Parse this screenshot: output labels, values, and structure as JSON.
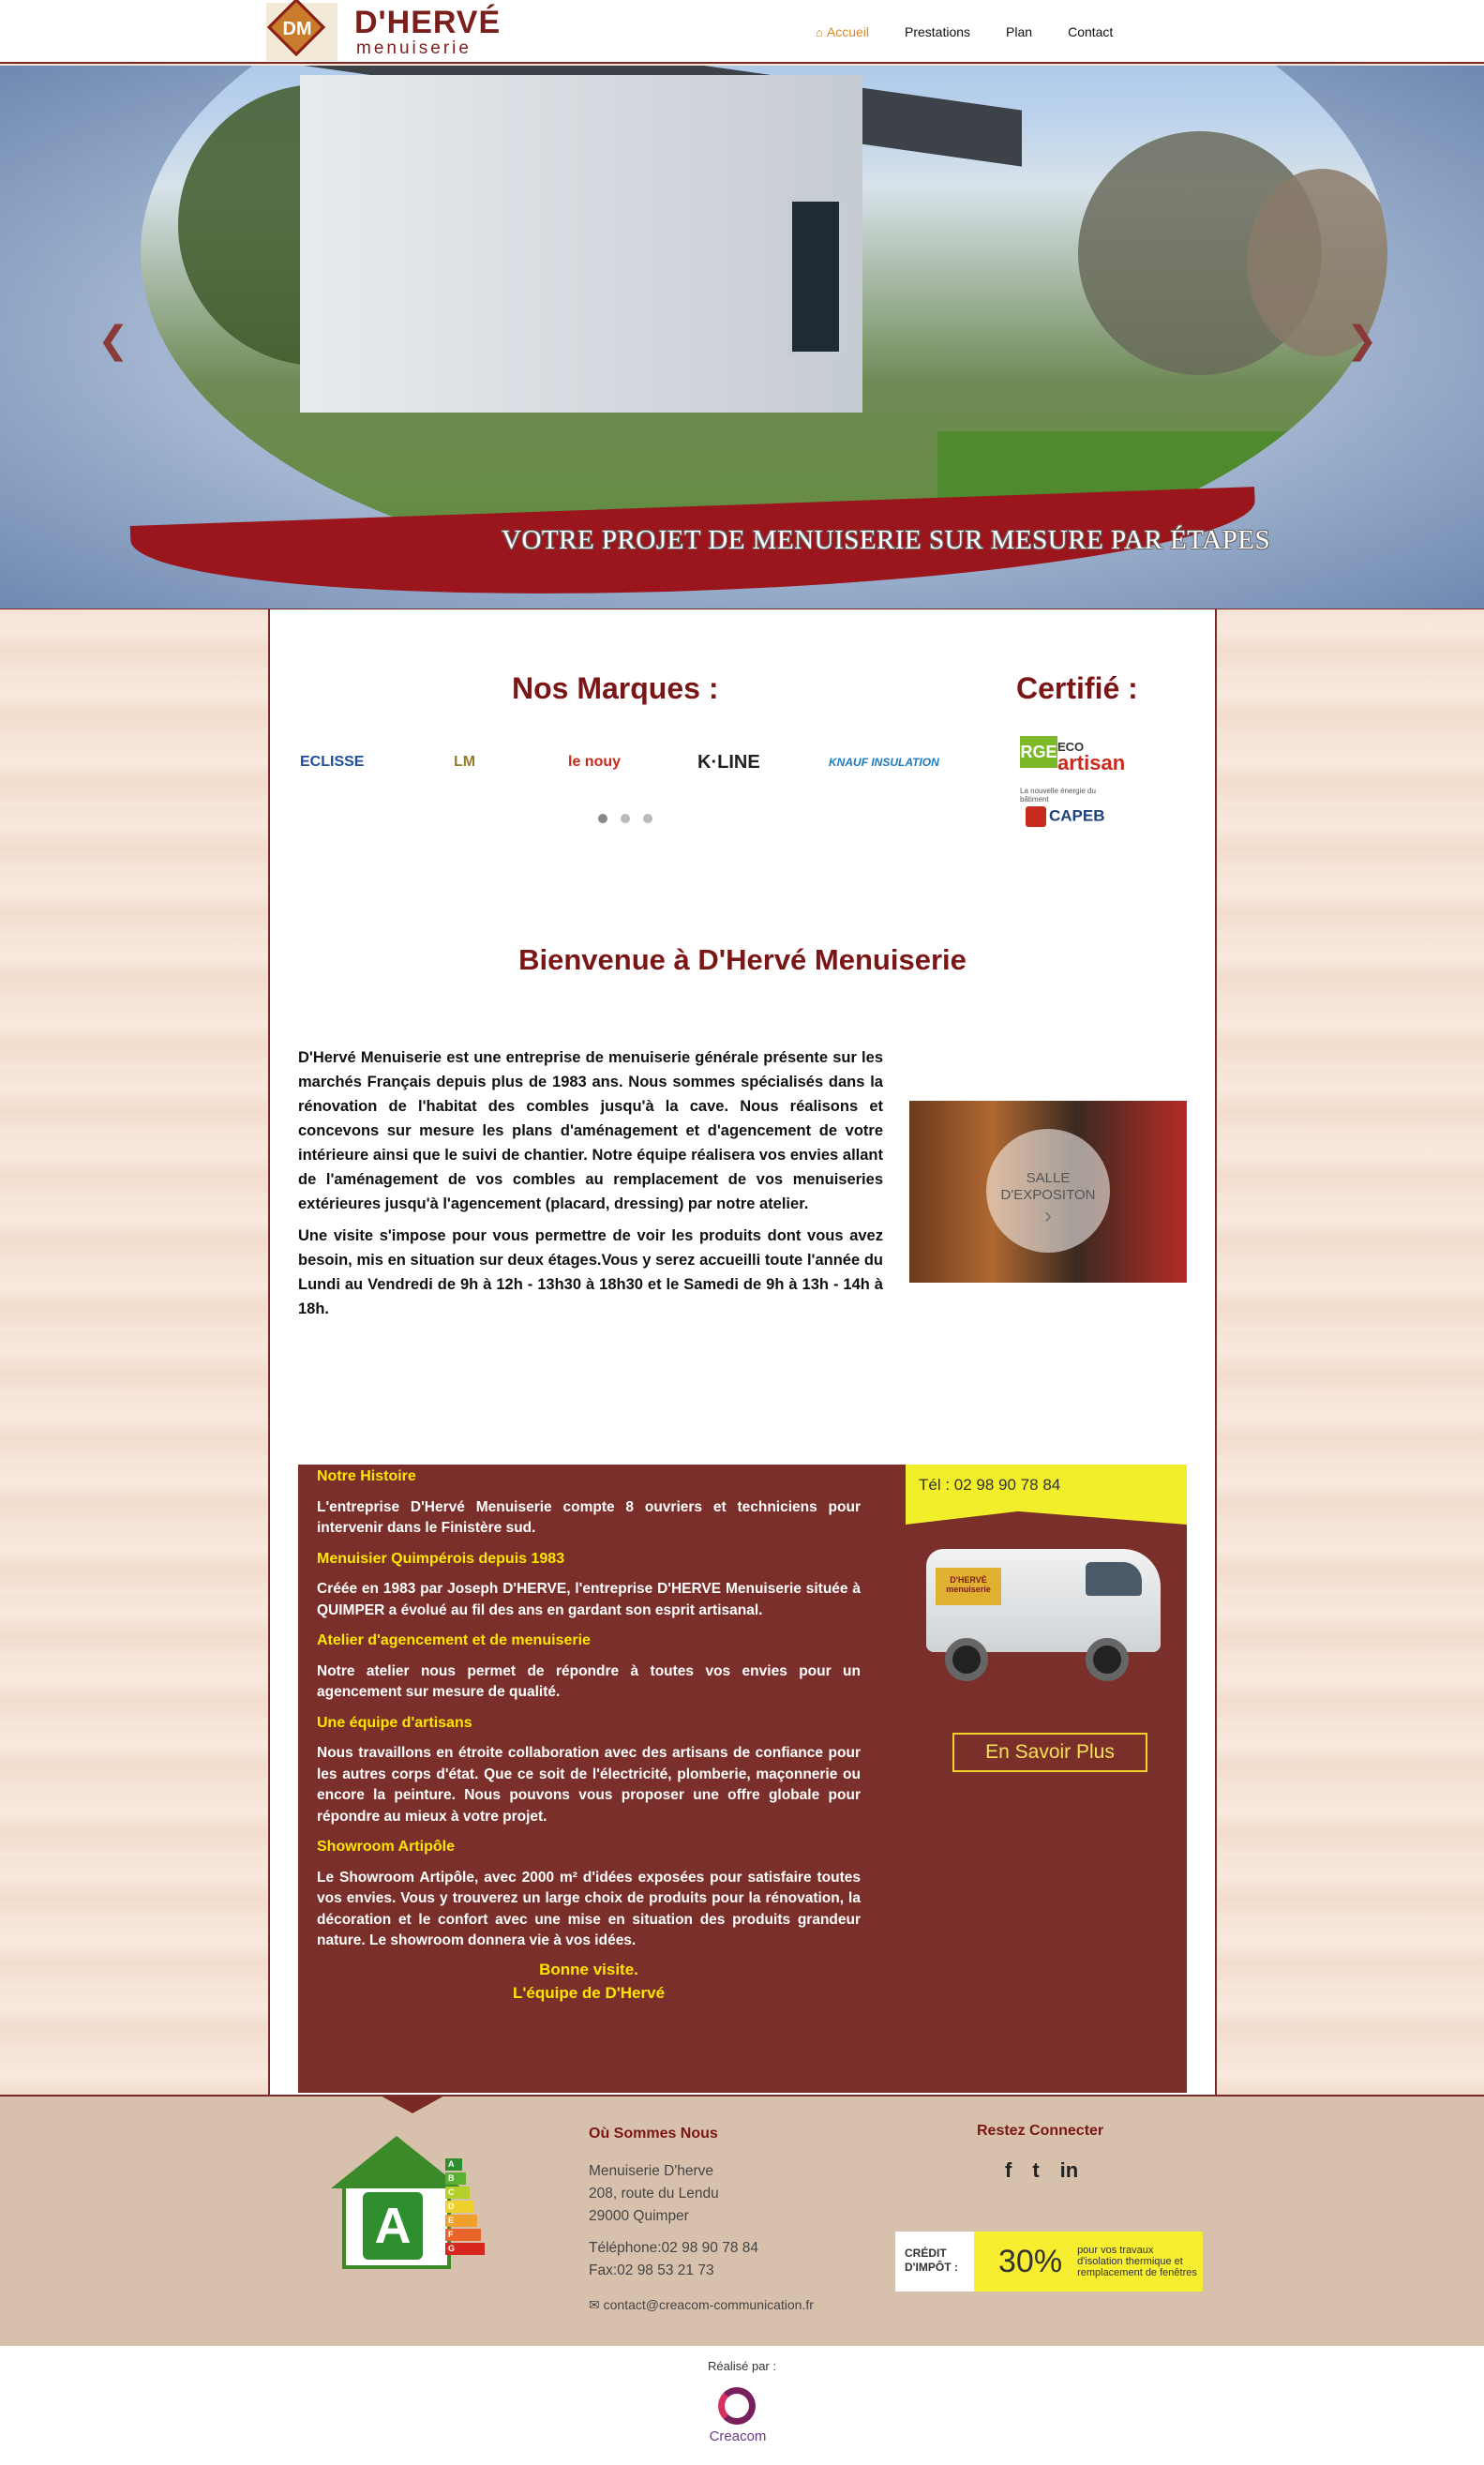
{
  "logo": {
    "initials": "DM",
    "name": "D'HERVÉ",
    "subtitle": "menuiserie"
  },
  "nav": {
    "items": [
      {
        "label": "Accueil",
        "active": true
      },
      {
        "label": "Prestations"
      },
      {
        "label": "Plan"
      },
      {
        "label": "Contact"
      }
    ]
  },
  "hero": {
    "tagline": "VOTRE PROJET DE MENUISERIE SUR MESURE PAR ÉTAPES",
    "prev_icon": "chevron-left-icon",
    "next_icon": "chevron-right-icon"
  },
  "brands": {
    "title": "Nos Marques :",
    "items": [
      "ECLISSE",
      "LM",
      "le nouy",
      "K·LINE",
      "KNAUF INSULATION"
    ],
    "slider_pages": 3,
    "active_page": 1
  },
  "certified": {
    "title": "Certifié :",
    "rge": {
      "letters": "RGE",
      "eco": "ECO",
      "artisan": "artisan",
      "tagline": "La nouvelle énergie du bâtiment"
    },
    "capeb": "CAPEB"
  },
  "welcome": {
    "title": "Bienvenue à  D'Hervé Menuiserie"
  },
  "intro": {
    "p1": "D'Hervé Menuiserie est une entreprise de menuiserie générale présente sur les marchés Français depuis plus de 1983 ans. Nous sommes spécialisés dans la rénovation de l'habitat des combles jusqu'à la cave. Nous réalisons et concevons sur mesure les plans d'aménagement et d'agencement de votre intérieure ainsi que le suivi de chantier. Notre équipe réalisera vos envies allant de l'aménagement de vos combles au remplacement de vos menuiseries extérieures jusqu'à l'agencement (placard, dressing) par notre atelier.",
    "p2": "Une visite s'impose pour vous permettre de voir les produits dont vous avez besoin, mis en situation sur deux étages.Vous y serez accueilli toute l'année du Lundi au Vendredi de 9h à 12h - 13h30 à 18h30 et le Samedi de 9h à 13h - 14h à 18h."
  },
  "salle": {
    "line1": "SALLE",
    "line2": "D'EXPOSITON",
    "icon": "chevron-right-icon"
  },
  "history": {
    "sections": [
      {
        "title": "Notre Histoire",
        "text": "L'entreprise D'Hervé Menuiserie compte 8 ouvriers et techniciens pour intervenir dans le Finistère sud."
      },
      {
        "title": "Menuisier Quimpérois depuis 1983",
        "text": "Créée en 1983 par Joseph D'HERVE, l'entreprise D'HERVE Menuiserie située à QUIMPER a évolué au fil des ans en gardant son esprit artisanal."
      },
      {
        "title": "Atelier d'agencement et de menuiserie",
        "text": "Notre atelier nous permet de répondre à toutes vos envies pour un agencement sur mesure de qualité."
      },
      {
        "title": "Une équipe d'artisans",
        "text": "Nous travaillons en étroite collaboration avec des artisans de confiance pour les autres corps d'état. Que ce soit de l'électricité, plomberie, maçonnerie ou encore la peinture. Nous pouvons vous proposer une offre globale pour répondre au mieux à votre projet."
      },
      {
        "title": "Showroom Artipôle",
        "text": "Le Showroom Artipôle, avec 2000 m² d'idées exposées pour satisfaire toutes vos envies. Vous y trouverez un large choix de produits pour la rénovation, la décoration et le confort avec une mise en situation des produits grandeur nature. Le showroom donnera vie à vos idées."
      }
    ],
    "sign1": "Bonne visite.",
    "sign2": "L'équipe de  D'Hervé",
    "tel": "Tél : 02 98 90 78 84",
    "van_label": "D'HERVÉ menuiserie",
    "button": "En Savoir Plus"
  },
  "footer": {
    "energy_label": "A",
    "energy_classes": [
      "A",
      "B",
      "C",
      "D",
      "E",
      "F",
      "G"
    ],
    "where": {
      "title": "Où Sommes Nous",
      "name": "Menuiserie D'herve",
      "street": "208, route du Lendu",
      "city": "29000  Quimper",
      "phone": "Téléphone:02 98 90 78 84",
      "fax": "Fax:02 98 53 21 73",
      "email": "contact@creacom-communication.fr"
    },
    "social": {
      "title": "Restez Connecter",
      "icons": [
        "facebook-icon",
        "twitter-icon",
        "linkedin-icon"
      ],
      "glyphs": [
        "f",
        "t",
        "in"
      ]
    },
    "credit": {
      "left": "CRÉDIT D'IMPÔT :",
      "percent": "30%",
      "right": "pour vos travaux d'isolation thermique et remplacement de fenêtres"
    }
  },
  "bottom": {
    "realise": "Réalisé par :",
    "agency": "Creacom"
  },
  "colors": {
    "brand_red": "#7a1616",
    "accent_orange": "#d98b1e",
    "panel_red": "#7a2f2a",
    "yellow": "#ffe600"
  }
}
